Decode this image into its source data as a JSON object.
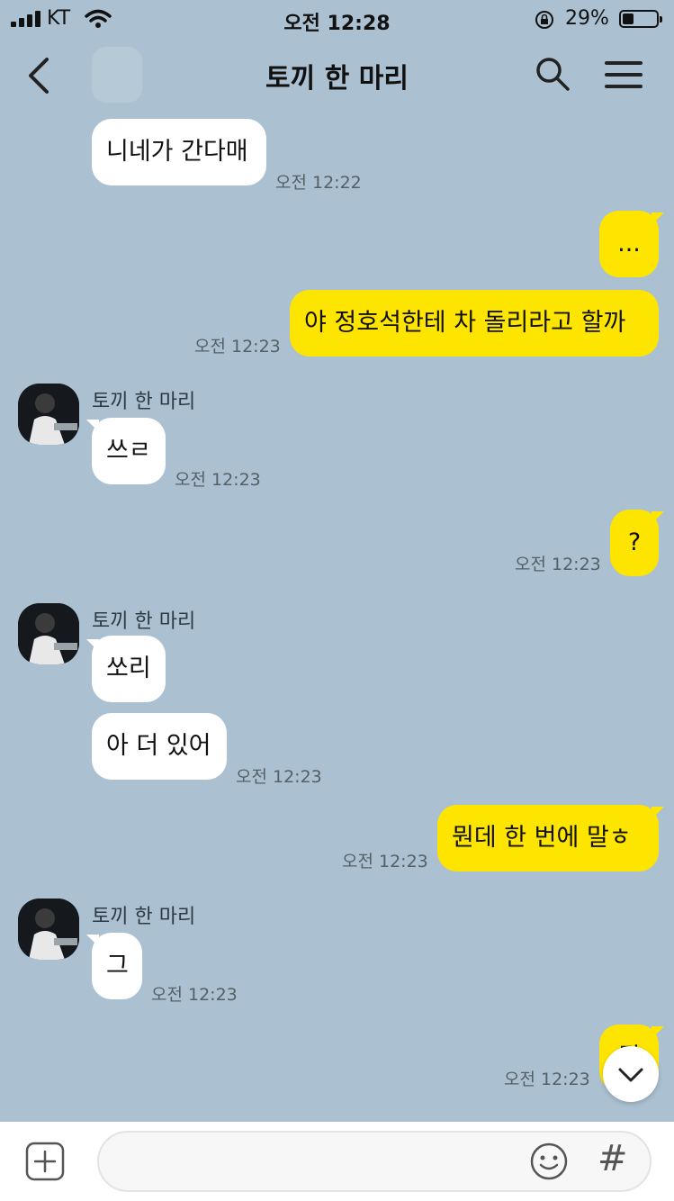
{
  "status_bar": {
    "carrier": "KT",
    "time": "오전 12:28",
    "battery": "29%"
  },
  "header": {
    "title": "토끼 한 마리"
  },
  "messages": [
    {
      "text": "니네가 간다매",
      "time": "오전 12:22"
    },
    {
      "text": "...",
      "time": ""
    },
    {
      "text": "야 정호석한테 차 돌리라고 할까",
      "time": "오전 12:23"
    },
    {
      "sender": "토끼 한 마리",
      "text": "쓰ㄹ",
      "time": "오전 12:23"
    },
    {
      "text": "?",
      "time": "오전 12:23"
    },
    {
      "sender": "토끼 한 마리",
      "text": "쏘리",
      "time": ""
    },
    {
      "text": "아 더 있어",
      "time": "오전 12:23"
    },
    {
      "text": "뭔데 한 번에 말ㅎ",
      "time": "오전 12:23"
    },
    {
      "sender": "토끼 한 마리",
      "text": "그",
      "time": "오전 12:23"
    },
    {
      "text": "뭐",
      "time": "오전 12:23"
    }
  ],
  "composer": {
    "hash_label": "#"
  },
  "colors": {
    "background": "#abc1d1",
    "outgoing_bubble": "#fee500",
    "incoming_bubble": "#ffffff"
  }
}
